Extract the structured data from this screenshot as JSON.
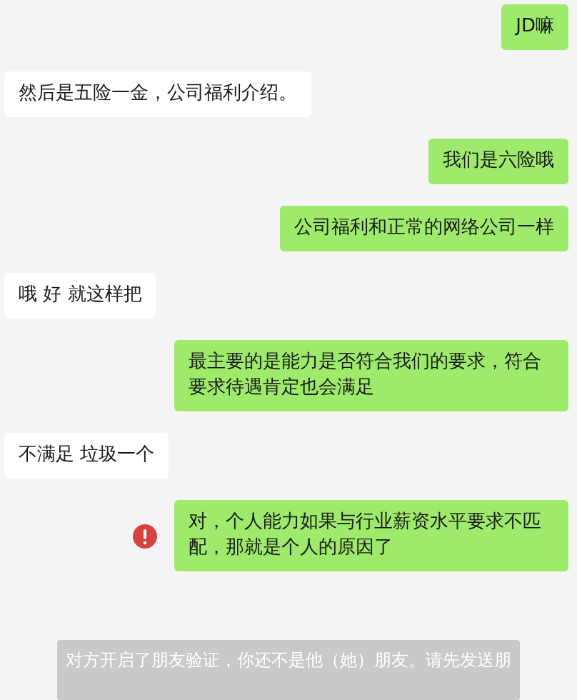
{
  "messages": [
    {
      "kind": "sent",
      "text": "JD嘛",
      "failed": false
    },
    {
      "kind": "received",
      "text": "然后是五险一金，公司福利介绍。",
      "failed": false
    },
    {
      "kind": "sent",
      "text": "我们是六险哦",
      "failed": false
    },
    {
      "kind": "sent",
      "text": "公司福利和正常的网络公司一样",
      "failed": false
    },
    {
      "kind": "received",
      "text": "哦 好 就这样把",
      "failed": false
    },
    {
      "kind": "sent",
      "text": "最主要的是能力是否符合我们的要求，符合要求待遇肯定也会满足",
      "failed": false
    },
    {
      "kind": "received",
      "text": "不满足 垃圾一个",
      "failed": false
    },
    {
      "kind": "sent",
      "text": "对，个人能力如果与行业薪资水平要求不匹配，那就是个人的原因了",
      "failed": true
    }
  ],
  "system_notice": "对方开启了朋友验证，你还不是他（她）朋友。请先发送朋"
}
